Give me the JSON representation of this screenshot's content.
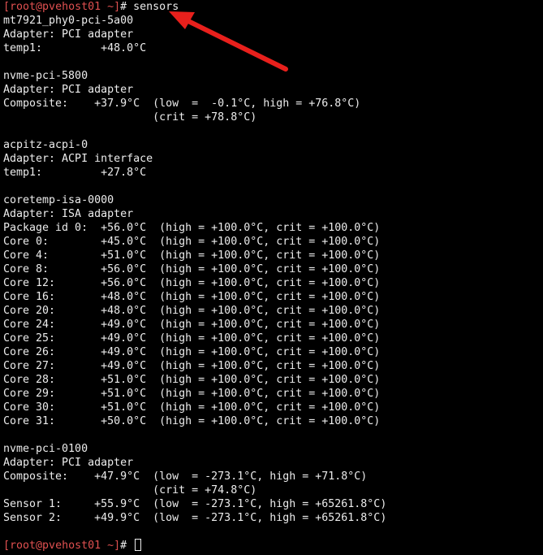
{
  "terminal": {
    "prompt": {
      "open_bracket": "[",
      "user": "root",
      "at_host": "@pvehost01",
      "path": " ~",
      "close_bracket": "]",
      "hash": "# "
    },
    "command": "sensors",
    "output": [
      "mt7921_phy0-pci-5a00",
      "Adapter: PCI adapter",
      "temp1:         +48.0°C",
      "",
      "nvme-pci-5800",
      "Adapter: PCI adapter",
      "Composite:    +37.9°C  (low  =  -0.1°C, high = +76.8°C)",
      "                       (crit = +78.8°C)",
      "",
      "acpitz-acpi-0",
      "Adapter: ACPI interface",
      "temp1:         +27.8°C",
      "",
      "coretemp-isa-0000",
      "Adapter: ISA adapter",
      "Package id 0:  +56.0°C  (high = +100.0°C, crit = +100.0°C)",
      "Core 0:        +45.0°C  (high = +100.0°C, crit = +100.0°C)",
      "Core 4:        +51.0°C  (high = +100.0°C, crit = +100.0°C)",
      "Core 8:        +56.0°C  (high = +100.0°C, crit = +100.0°C)",
      "Core 12:       +56.0°C  (high = +100.0°C, crit = +100.0°C)",
      "Core 16:       +48.0°C  (high = +100.0°C, crit = +100.0°C)",
      "Core 20:       +48.0°C  (high = +100.0°C, crit = +100.0°C)",
      "Core 24:       +49.0°C  (high = +100.0°C, crit = +100.0°C)",
      "Core 25:       +49.0°C  (high = +100.0°C, crit = +100.0°C)",
      "Core 26:       +49.0°C  (high = +100.0°C, crit = +100.0°C)",
      "Core 27:       +49.0°C  (high = +100.0°C, crit = +100.0°C)",
      "Core 28:       +51.0°C  (high = +100.0°C, crit = +100.0°C)",
      "Core 29:       +51.0°C  (high = +100.0°C, crit = +100.0°C)",
      "Core 30:       +51.0°C  (high = +100.0°C, crit = +100.0°C)",
      "Core 31:       +50.0°C  (high = +100.0°C, crit = +100.0°C)",
      "",
      "nvme-pci-0100",
      "Adapter: PCI adapter",
      "Composite:    +47.9°C  (low  = -273.1°C, high = +71.8°C)",
      "                       (crit = +74.8°C)",
      "Sensor 1:     +55.9°C  (low  = -273.1°C, high = +65261.8°C)",
      "Sensor 2:     +49.9°C  (low  = -273.1°C, high = +65261.8°C)",
      ""
    ]
  },
  "colors": {
    "background": "#000000",
    "text": "#ececec",
    "prompt": "#e05050",
    "annotation_arrow": "#e8201c"
  },
  "icons": {
    "annotation": "red-arrow-icon",
    "cursor": "block-cursor-icon"
  }
}
